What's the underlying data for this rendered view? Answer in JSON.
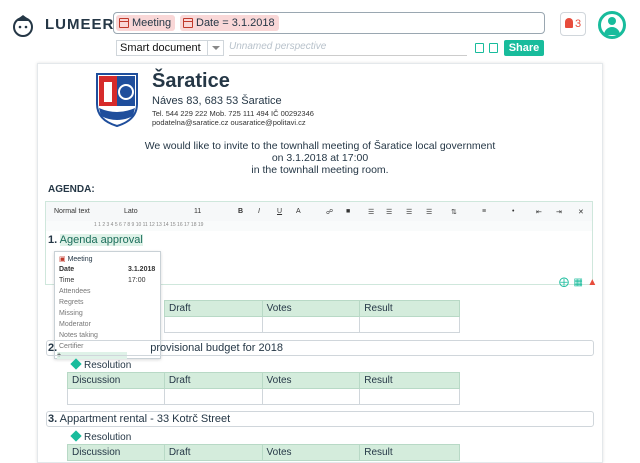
{
  "app": {
    "brand": "LUMEER"
  },
  "search": {
    "chips": [
      "Meeting",
      "Date = 3.1.2018"
    ]
  },
  "notifications": {
    "count": "3"
  },
  "perspective": {
    "type": "Smart document",
    "name_placeholder": "Unnamed perspective",
    "share_label": "Share"
  },
  "letterhead": {
    "town": "Šaratice",
    "address": "Náves 83, 683 53 Šaratice",
    "phones": "Tel. 544 229 222  Mob. 725 111 494  IČ 00292346",
    "emails": "podatelna@saratice.cz ousaratice@politavi.cz"
  },
  "invite": {
    "line1": "We would like to invite to the townhall meeting of Šaratice local government",
    "line2": "on 3.1.2018 at 17:00",
    "line3": "in the townhall meeting room."
  },
  "agenda_label": "AGENDA:",
  "toolbar": {
    "style": "Normal text",
    "font": "Lato",
    "size": "11",
    "bold": "B",
    "italic": "I",
    "underline": "U",
    "color": "A",
    "ruler": "1  1  2  3  4  5  6  7  8  9  10  11  12  13  14  15  16  17  18  19"
  },
  "items": [
    {
      "num": "1.",
      "title": "Agenda approval"
    },
    {
      "num": "2.",
      "title": "provisional budget for 2018"
    },
    {
      "num": "3.",
      "title": "Appartment rental - 33 Kotrč Street"
    }
  ],
  "popup": {
    "title": "Meeting",
    "rows": [
      {
        "label": "Date",
        "value": "3.1.2018"
      },
      {
        "label": "Time",
        "value": "17:00"
      },
      {
        "label": "Attendees",
        "value": ""
      },
      {
        "label": "Regrets",
        "value": ""
      },
      {
        "label": "Missing",
        "value": ""
      },
      {
        "label": "Moderator",
        "value": ""
      },
      {
        "label": "Notes taking",
        "value": ""
      },
      {
        "label": "Certifier",
        "value": ""
      }
    ],
    "plus": "+"
  },
  "resolution_label": "Resolution",
  "table_headers": [
    "Discussion",
    "Draft",
    "Votes",
    "Result"
  ],
  "colors": {
    "accent": "#18bc9c",
    "alert": "#e74c3c",
    "chip": "#f9d7d7",
    "header": "#d4ecdc"
  }
}
